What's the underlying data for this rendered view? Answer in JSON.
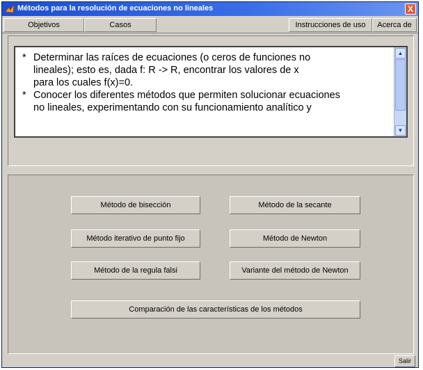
{
  "window": {
    "title": "Métodos para la resolución de ecuaciones no lineales",
    "close_label": "X"
  },
  "menu": {
    "objetivos": "Objetivos",
    "casos": "Casos",
    "instrucciones": "Instrucciones de uso",
    "acerca": "Acerca de"
  },
  "objectives": {
    "bullet": "*",
    "item1": [
      "Determinar  las  raíces  de  ecuaciones (o ceros  de funciones no",
      "lineales); esto es, dada f: R -> R, encontrar  los  valores  de x",
      "para los cuales f(x)=0."
    ],
    "item2": [
      "Conocer los diferentes métodos que permiten solucionar ecuaciones",
      "no  lineales,  experimentando  con su  funcionamiento analítico y"
    ]
  },
  "methods": {
    "biseccion": "Método de bisección",
    "secante": "Método de la secante",
    "punto_fijo": "Método iterativo de punto fijo",
    "newton": "Método de Newton",
    "regula_falsi": "Método de la regula falsi",
    "variante_newton": "Variante del método de Newton",
    "comparacion": "Comparación de las características de los métodos"
  },
  "footer": {
    "exit": "Salir"
  },
  "colors": {
    "titlebar": "#1c4fd1",
    "panel": "#d4d0c8",
    "button_panel": "#c8c4bb"
  }
}
